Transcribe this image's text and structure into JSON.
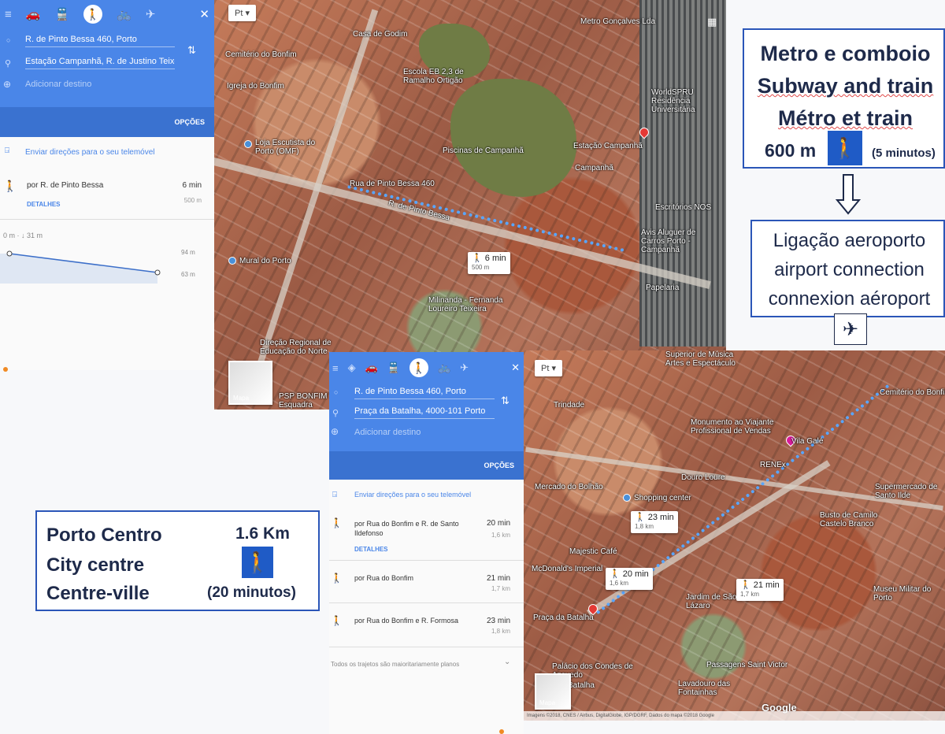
{
  "poster_top": {
    "lines": [
      "Metro e comboio",
      "Subway and train",
      "Métro et train"
    ],
    "distance": "600 m",
    "duration": "(5 minutos)",
    "arrow_icon": "down-arrow-icon",
    "connection_lines": [
      "Ligação aeroporto",
      "airport connection",
      "connexion aéroport"
    ],
    "plane_icon": "airplane-icon"
  },
  "poster_bottom": {
    "lines": [
      "Porto Centro",
      "City centre",
      "Centre-ville"
    ],
    "distance": "1.6 Km",
    "duration": "(20 minutos)"
  },
  "panel1": {
    "origin": "R. de Pinto Bessa 460, Porto",
    "destination": "Estação Campanhã, R. de Justino Teixe",
    "add_destination": "Adicionar destino",
    "options": "OPÇÕES",
    "send_directions": "Enviar direções para o seu telemóvel",
    "route": {
      "name": "por R. de Pinto Bessa",
      "time": "6 min",
      "distance": "500 m",
      "details": "DETALHES"
    },
    "elevation": {
      "summary": "0 m · ↓ 31 m",
      "high": "94 m",
      "low": "63 m"
    }
  },
  "map1": {
    "search_prefix": "Pt",
    "labels": [
      "Casa de Godim",
      "Cemitério do Bonfim",
      "Igreja do Bonfim",
      "Escola EB 2,3 de Ramalho Ortigão",
      "Metro Gonçalves Lda",
      "WorldSPRU Residência Universitária",
      "Loja Escutista do Porto (OMF)",
      "Piscinas de Campanhã",
      "Estação Campanhã",
      "Campanhã",
      "Rua de Pinto Bessa 460",
      "R. de Pinto Bessa",
      "Escritórios NOS",
      "Avis Aluguer de Carros Porto - Campanhã",
      "Mural do Porto",
      "Papelaria",
      "Milinanda - Fernanda Loureiro Teixeira",
      "Direção Regional de Educação do Norte",
      "PSP BONFIM 3ª Esquadra"
    ],
    "callout": {
      "time": "6 min",
      "distance": "500 m"
    },
    "thumb": "Mapa"
  },
  "panel2": {
    "origin": "R. de Pinto Bessa 460, Porto",
    "destination": "Praça da Batalha, 4000-101 Porto",
    "add_destination": "Adicionar destino",
    "options": "OPÇÕES",
    "send_directions": "Enviar direções para o seu telemóvel",
    "routes": [
      {
        "name": "por Rua do Bonfim e R. de Santo Ildefonso",
        "time": "20 min",
        "distance": "1,6 km",
        "details": "DETALHES"
      },
      {
        "name": "por Rua do Bonfim",
        "time": "21 min",
        "distance": "1,7 km"
      },
      {
        "name": "por Rua do Bonfim e R. Formosa",
        "time": "23 min",
        "distance": "1,8 km"
      }
    ],
    "footer": "Todos os trajetos são maioritariamente planos"
  },
  "map2": {
    "search_prefix": "Pt",
    "labels": [
      "Superior de Música Artes e Espectáculo",
      "Cemitério do Bonfim",
      "Trindade",
      "Monumento ao Viajante Profissional de Vendas",
      "Vila Galé",
      "RENEx",
      "Mercado do Bolhão",
      "Douro Loure",
      "Shopping center",
      "Supermercado de Santo Ilde",
      "Busto de Camilo Castelo Branco",
      "Majestic Café",
      "McDonald's Imperial",
      "Praça da Batalha",
      "Jardim de São Lázaro",
      "Museu Militar do Porto",
      "Palácio dos Condes de Azevedo",
      "Passagens Saint Victor",
      "Batalha",
      "Lavadouro das Fontainhas",
      "Google"
    ],
    "callouts": [
      {
        "time": "23 min",
        "distance": "1,8 km"
      },
      {
        "time": "20 min",
        "distance": "1,6 km"
      },
      {
        "time": "21 min",
        "distance": "1,7 km"
      }
    ],
    "thumb": "Mapa",
    "attribution": "Imagens ©2018, CNES / Airbus, DigitalGlobe, IGP/DGRF, Dados do mapa ©2018 Google"
  },
  "colors": {
    "panel_blue": "#4a86e8",
    "poster_border": "#2b56b8",
    "walk_icon_bg": "#1f5bc6",
    "route": "#58a6ff"
  }
}
